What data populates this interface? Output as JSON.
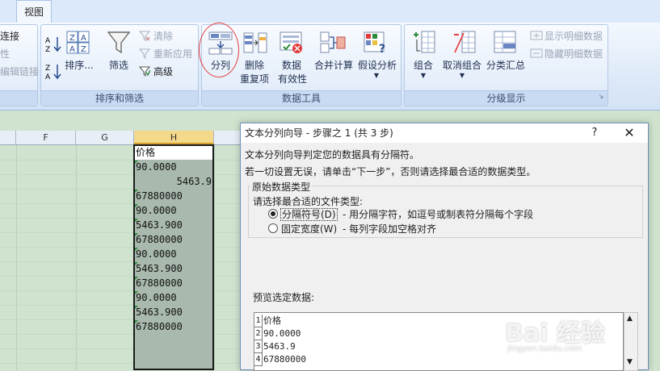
{
  "ribbon": {
    "tab_view": "视图",
    "left_partial": {
      "item1": "连接",
      "item2": "性",
      "item3": "编辑链接"
    },
    "sort_filter": {
      "sort_label": "排序...",
      "filter_label": "筛选",
      "clear_label": "清除",
      "reapply_label": "重新应用",
      "advanced_label": "高级",
      "group_label": "排序和筛选"
    },
    "data_tools": {
      "split_label": "分列",
      "remove_dup_label_1": "删除",
      "remove_dup_label_2": "重复项",
      "validation_label_1": "数据",
      "validation_label_2": "有效性",
      "consolidate_label": "合并计算",
      "whatif_label": "假设分析",
      "group_label": "数据工具"
    },
    "outline": {
      "group_btn_label": "组合",
      "ungroup_label": "取消组合",
      "subtotal_label": "分类汇总",
      "show_detail_label": "显示明细数据",
      "hide_detail_label": "隐藏明细数据",
      "group_label": "分级显示"
    }
  },
  "sheet": {
    "columns": [
      "F",
      "G",
      "H"
    ],
    "cells": [
      "价格",
      "90.0000",
      "5463.9",
      "67880000",
      "90.0000",
      "5463.900",
      "67880000",
      "90.0000",
      "5463.900",
      "67880000",
      "90.0000",
      "5463.900",
      "67880000"
    ]
  },
  "dialog": {
    "title": "文本分列向导 - 步骤之 1 (共 3 步)",
    "help": "?",
    "close": "✕",
    "line1": "文本分列向导判定您的数据具有分隔符。",
    "line2": "若一切设置无误，请单击“下一步”，否则请选择最合适的数据类型。",
    "section_label": "原始数据类型",
    "prompt": "请选择最合适的文件类型:",
    "option1_label": "分隔符号(D)",
    "option1_desc": "- 用分隔字符，如逗号或制表符分隔每个字段",
    "option2_label": "固定宽度(W)",
    "option2_desc": "- 每列字段加空格对齐",
    "preview_label": "预览选定数据:",
    "preview_rows": [
      {
        "num": "1",
        "text": "价格"
      },
      {
        "num": "2",
        "text": "90.0000"
      },
      {
        "num": "3",
        "text": "5463.9"
      },
      {
        "num": "4",
        "text": "67880000"
      }
    ]
  },
  "watermark": {
    "main": "Bai 经验",
    "sub": "jingyan.baidu.com"
  },
  "colors": {
    "highlight_circle": "#e23b3b",
    "ribbon_bg": "#dfeaf8",
    "sheet_bg": "#cfe3cf"
  }
}
